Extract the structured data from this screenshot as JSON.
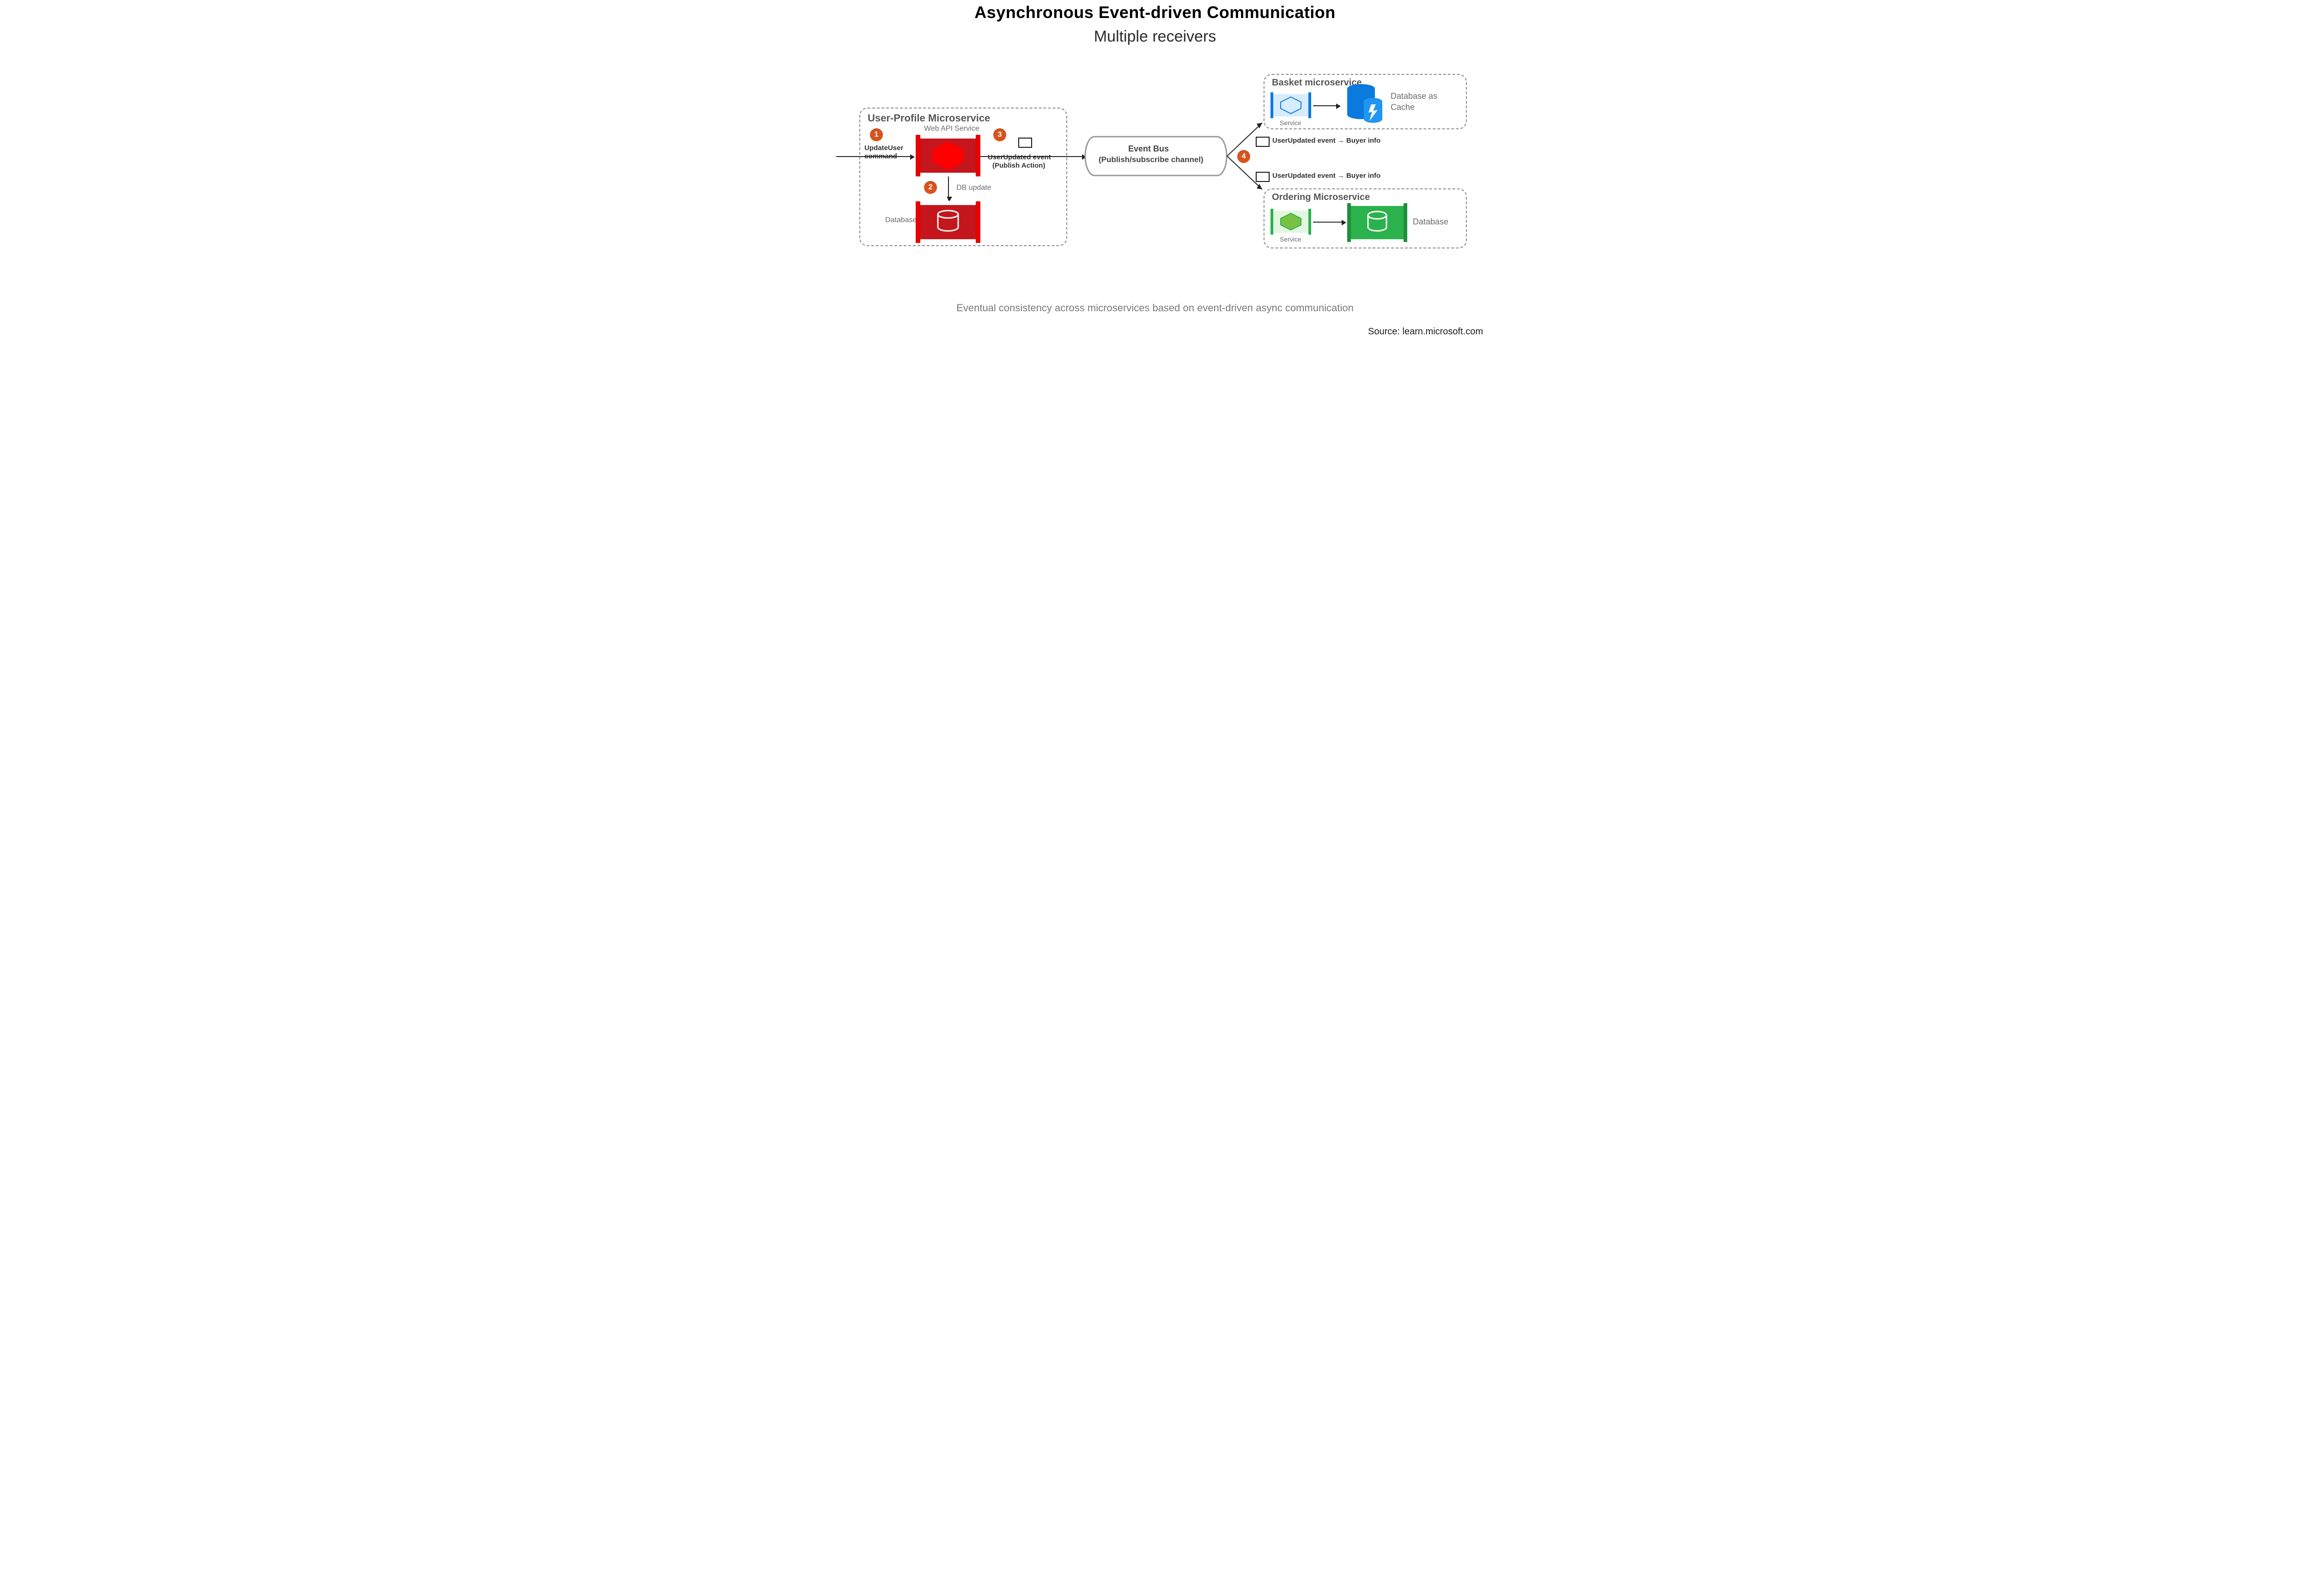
{
  "title": "Asynchronous Event-driven Communication",
  "subtitle": "Multiple receivers",
  "caption": "Eventual consistency across microservices based on event-driven async communication",
  "source": "Source: learn.microsoft.com",
  "colors": {
    "step": "#d9531e",
    "red": "#c4161c",
    "red_accent": "#e60000",
    "blue": "#0a7adf",
    "green": "#2bb24c",
    "green_fill": "#79c143",
    "gray_text": "#6b6b6b",
    "panel_border": "#8a8a8a"
  },
  "steps": {
    "s1": "1",
    "s2": "2",
    "s3": "3",
    "s4": "4"
  },
  "panels": {
    "user_profile": {
      "title": "User-Profile Microservice",
      "api_label": "Web API Service",
      "db_label": "Database",
      "db_update_label": "DB update",
      "cmd_line1": "UpdateUser",
      "cmd_line2": "command",
      "publish_line1": "UserUpdated event",
      "publish_line2": "(Publish Action)"
    },
    "basket": {
      "title": "Basket microservice",
      "service_label": "Service",
      "db_line1": "Database as",
      "db_line2": "Cache"
    },
    "ordering": {
      "title": "Ordering Microservice",
      "service_label": "Service",
      "db_label": "Database"
    }
  },
  "event_bus": {
    "line1": "Event Bus",
    "line2": "(Publish/subscribe channel)"
  },
  "events": {
    "to_basket": "UserUpdated event → Buyer info",
    "to_ordering": "UserUpdated event → Buyer info"
  }
}
